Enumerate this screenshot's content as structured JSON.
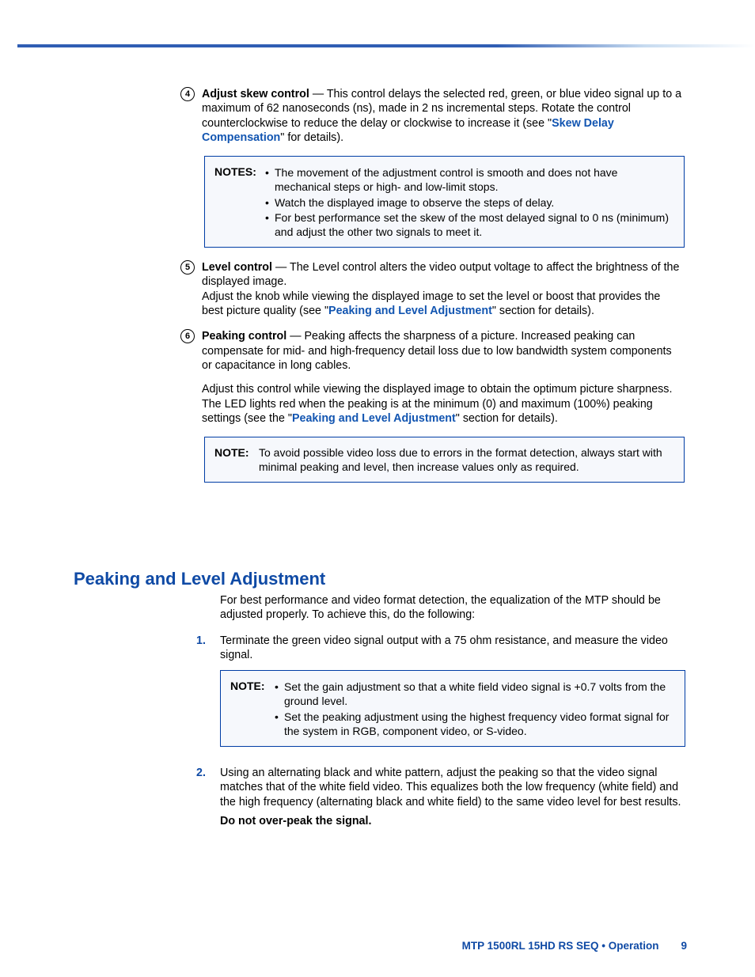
{
  "item4": {
    "num": "4",
    "term": "Adjust skew control",
    "text_a": " — This control delays the selected red, green, or blue video signal up to a maximum of 62 nanoseconds (ns), made in 2 ns incremental steps. Rotate the control counterclockwise to reduce the delay or clockwise to increase it (see \"",
    "link": "Skew Delay Compensation",
    "text_b": "\" for details)."
  },
  "notes1": {
    "label": "NOTES:",
    "b1": "The movement of the adjustment control is smooth and does not have mechanical steps or high- and low-limit stops.",
    "b2": "Watch the displayed image to observe the steps of delay.",
    "b3": "For best performance set the skew of the most delayed signal to 0 ns (minimum) and adjust the other two signals to meet it."
  },
  "item5": {
    "num": "5",
    "term": "Level control",
    "text_a": " — The Level control alters the video output voltage to affect the brightness of the displayed image.",
    "text_b": "Adjust the knob while viewing the displayed image to set the level or boost that provides the best picture quality (see \"",
    "link": "Peaking and Level Adjustment",
    "text_c": "\" section for details)."
  },
  "item6": {
    "num": "6",
    "term": "Peaking control",
    "text_a": " — Peaking affects the sharpness of a picture. Increased peaking can compensate for mid- and high-frequency detail loss due to low bandwidth system components or capacitance in long cables.",
    "text_b": "Adjust this control while viewing the displayed image to obtain the optimum picture sharpness. The LED lights red when the peaking is at the minimum (0) and maximum (100%) peaking settings (see the \"",
    "link": "Peaking and Level Adjustment",
    "text_c": "\" section for details)."
  },
  "note2": {
    "label": "NOTE:",
    "text": "To avoid possible video loss due to errors in the format detection, always start with minimal peaking and level, then increase values only as required."
  },
  "section2": {
    "heading": "Peaking and Level Adjustment",
    "intro": "For best performance and video format detection, the equalization of the MTP should be adjusted properly. To achieve this, do the following:",
    "step1_num": "1.",
    "step1": "Terminate the green video signal output with a 75 ohm resistance, and measure the video signal.",
    "note": {
      "label": "NOTE:",
      "b1": "Set the gain adjustment so that a white field video signal is +0.7 volts from the ground level.",
      "b2": "Set the peaking adjustment using the highest frequency video format signal for the system in RGB, component video, or S-video."
    },
    "step2_num": "2.",
    "step2": "Using an alternating black and white pattern, adjust the peaking so that the video signal matches that of the white field video. This equalizes both the low frequency (white field) and the high frequency (alternating black and white field) to the same video level for best results.",
    "warn": "Do not over-peak the signal."
  },
  "footer": {
    "doc": "MTP 1500RL 15HD RS SEQ • Operation",
    "page": "9"
  }
}
